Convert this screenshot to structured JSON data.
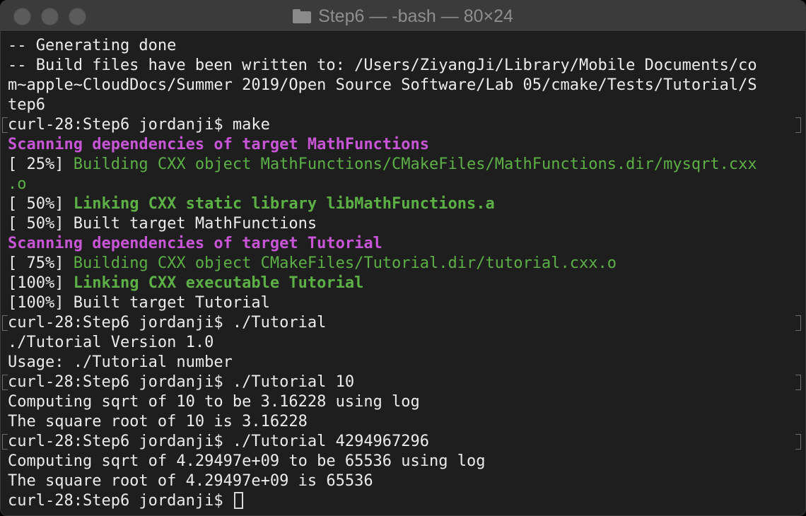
{
  "window": {
    "title": "Step6 — -bash — 80×24"
  },
  "terminal": {
    "lines": [
      {
        "segments": [
          {
            "text": "-- Generating done",
            "style": "plain"
          }
        ]
      },
      {
        "segments": [
          {
            "text": "-- Build files have been written to: /Users/ZiyangJi/Library/Mobile Documents/co",
            "style": "plain"
          }
        ]
      },
      {
        "segments": [
          {
            "text": "m~apple~CloudDocs/Summer 2019/Open Source Software/Lab 05/cmake/Tests/Tutorial/S",
            "style": "plain"
          }
        ]
      },
      {
        "segments": [
          {
            "text": "tep6",
            "style": "plain"
          }
        ]
      },
      {
        "prompt": true,
        "segments": [
          {
            "text": "curl-28:Step6 jordanji$ make",
            "style": "plain"
          }
        ]
      },
      {
        "segments": [
          {
            "text": "Scanning dependencies of target MathFunctions",
            "style": "purple"
          }
        ]
      },
      {
        "segments": [
          {
            "text": "[ 25%] ",
            "style": "plain"
          },
          {
            "text": "Building CXX object MathFunctions/CMakeFiles/MathFunctions.dir/mysqrt.cxx",
            "style": "green"
          }
        ]
      },
      {
        "segments": [
          {
            "text": ".o",
            "style": "green"
          }
        ]
      },
      {
        "segments": [
          {
            "text": "[ 50%] ",
            "style": "plain"
          },
          {
            "text": "Linking CXX static library libMathFunctions.a",
            "style": "green-bold"
          }
        ]
      },
      {
        "segments": [
          {
            "text": "[ 50%] Built target MathFunctions",
            "style": "plain"
          }
        ]
      },
      {
        "segments": [
          {
            "text": "Scanning dependencies of target Tutorial",
            "style": "purple"
          }
        ]
      },
      {
        "segments": [
          {
            "text": "[ 75%] ",
            "style": "plain"
          },
          {
            "text": "Building CXX object CMakeFiles/Tutorial.dir/tutorial.cxx.o",
            "style": "green"
          }
        ]
      },
      {
        "segments": [
          {
            "text": "[100%] ",
            "style": "plain"
          },
          {
            "text": "Linking CXX executable Tutorial",
            "style": "green-bold"
          }
        ]
      },
      {
        "segments": [
          {
            "text": "[100%] Built target Tutorial",
            "style": "plain"
          }
        ]
      },
      {
        "prompt": true,
        "segments": [
          {
            "text": "curl-28:Step6 jordanji$ ./Tutorial",
            "style": "plain"
          }
        ]
      },
      {
        "segments": [
          {
            "text": "./Tutorial Version 1.0",
            "style": "plain"
          }
        ]
      },
      {
        "segments": [
          {
            "text": "Usage: ./Tutorial number",
            "style": "plain"
          }
        ]
      },
      {
        "prompt": true,
        "segments": [
          {
            "text": "curl-28:Step6 jordanji$ ./Tutorial 10",
            "style": "plain"
          }
        ]
      },
      {
        "segments": [
          {
            "text": "Computing sqrt of 10 to be 3.16228 using log",
            "style": "plain"
          }
        ]
      },
      {
        "segments": [
          {
            "text": "The square root of 10 is 3.16228",
            "style": "plain"
          }
        ]
      },
      {
        "prompt": true,
        "segments": [
          {
            "text": "curl-28:Step6 jordanji$ ./Tutorial 4294967296",
            "style": "plain"
          }
        ]
      },
      {
        "segments": [
          {
            "text": "Computing sqrt of 4.29497e+09 to be 65536 using log",
            "style": "plain"
          }
        ]
      },
      {
        "segments": [
          {
            "text": "The square root of 4.29497e+09 is 65536",
            "style": "plain"
          }
        ]
      },
      {
        "cursor": true,
        "segments": [
          {
            "text": "curl-28:Step6 jordanji$ ",
            "style": "plain"
          }
        ]
      }
    ]
  },
  "colors": {
    "background": "#1e1e1e",
    "text": "#ececec",
    "purple": "#c755d6",
    "green": "#5cb046"
  },
  "icons": {
    "title": "folder-icon"
  }
}
